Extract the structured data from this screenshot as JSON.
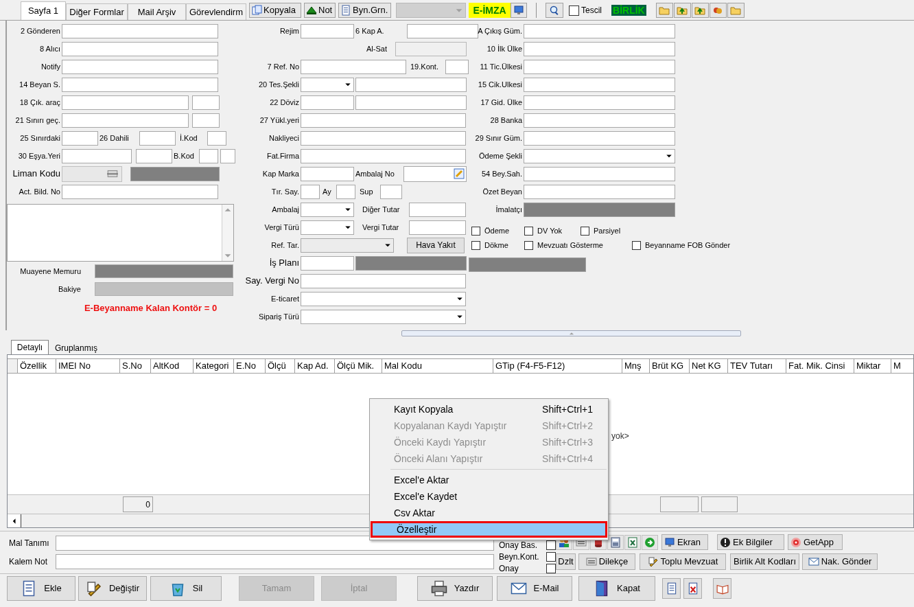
{
  "top_tabs": [
    {
      "label": "Sayfa 1",
      "selected": true
    },
    {
      "label": "Diğer Formlar",
      "selected": false
    },
    {
      "label": "Mail Arşiv",
      "selected": false
    },
    {
      "label": "Görevlendirm",
      "selected": false
    }
  ],
  "toolbar": {
    "buttons": [
      {
        "label": "Kopyala"
      },
      {
        "label": "Not"
      },
      {
        "label": "Byn.Grn."
      }
    ],
    "eimza": "E-İMZA",
    "tescil": {
      "label": "Tescil",
      "checked": false
    },
    "birlik": "BİRLİK"
  },
  "form": {
    "left": [
      [
        {
          "kind": "label",
          "text": "2 Gönderen"
        },
        {
          "kind": "input"
        }
      ],
      [
        {
          "kind": "label",
          "text": "8 Alıcı"
        },
        {
          "kind": "input"
        }
      ],
      [
        {
          "kind": "label",
          "text": "Notify"
        },
        {
          "kind": "input"
        }
      ],
      [
        {
          "kind": "label",
          "text": "14 Beyan S."
        },
        {
          "kind": "input"
        }
      ],
      [
        {
          "kind": "label",
          "text": "18 Çık. araç"
        },
        {
          "kind": "input"
        },
        {
          "kind": "input"
        }
      ],
      [
        {
          "kind": "label",
          "text": "21 Sınırı geç."
        },
        {
          "kind": "input"
        },
        {
          "kind": "input"
        }
      ],
      [
        {
          "kind": "label",
          "text": "25 Sınırdaki"
        },
        {
          "kind": "input"
        },
        {
          "kind": "label",
          "text": "26 Dahili"
        },
        {
          "kind": "input"
        },
        {
          "kind": "label",
          "text": "İ.Kod"
        },
        {
          "kind": "input"
        }
      ],
      [
        {
          "kind": "label",
          "text": "30 Eşya.Yeri"
        },
        {
          "kind": "input"
        },
        {
          "kind": "input"
        },
        {
          "kind": "label",
          "text": "B.Kod"
        },
        {
          "kind": "input"
        },
        {
          "kind": "input"
        }
      ],
      [
        {
          "kind": "label_lg",
          "text": "Liman Kodu"
        },
        {
          "kind": "lookup"
        },
        {
          "kind": "dark"
        }
      ],
      [
        {
          "kind": "label",
          "text": "Act. Bild. No"
        },
        {
          "kind": "input"
        }
      ]
    ],
    "middle": [
      [
        {
          "kind": "label",
          "text": "Rejim"
        },
        {
          "kind": "input"
        },
        {
          "kind": "label",
          "text": "6 Kap A."
        },
        {
          "kind": "input"
        }
      ],
      [
        {
          "kind": "label",
          "text": "Al-Sat"
        },
        {
          "kind": "readonly"
        }
      ],
      [
        {
          "kind": "label",
          "text": "7 Ref. No"
        },
        {
          "kind": "input"
        },
        {
          "kind": "label",
          "text": "19.Kont."
        },
        {
          "kind": "input"
        }
      ],
      [
        {
          "kind": "label",
          "text": "20 Tes.Şekli"
        },
        {
          "kind": "select"
        },
        {
          "kind": "input"
        }
      ],
      [
        {
          "kind": "label",
          "text": "22 Döviz"
        },
        {
          "kind": "input"
        },
        {
          "kind": "input"
        }
      ],
      [
        {
          "kind": "label",
          "text": "27 Yükl.yeri"
        },
        {
          "kind": "input"
        }
      ],
      [
        {
          "kind": "label",
          "text": "Nakliyeci"
        },
        {
          "kind": "input"
        }
      ],
      [
        {
          "kind": "label",
          "text": "Fat.Firma"
        },
        {
          "kind": "input"
        }
      ],
      [
        {
          "kind": "label",
          "text": "Kap Marka"
        },
        {
          "kind": "input"
        },
        {
          "kind": "label",
          "text": "Ambalaj No"
        },
        {
          "kind": "picker"
        }
      ],
      [
        {
          "kind": "label",
          "text": "Tır. Say."
        },
        {
          "kind": "input"
        },
        {
          "kind": "label",
          "text": "Ay"
        },
        {
          "kind": "input"
        },
        {
          "kind": "label",
          "text": "Sup"
        },
        {
          "kind": "input"
        }
      ],
      [
        {
          "kind": "label",
          "text": "Ambalaj"
        },
        {
          "kind": "select"
        },
        {
          "kind": "label",
          "text": "Diğer Tutar"
        },
        {
          "kind": "input"
        }
      ],
      [
        {
          "kind": "label",
          "text": "Vergi Türü"
        },
        {
          "kind": "select"
        },
        {
          "kind": "label",
          "text": "Vergi Tutar"
        },
        {
          "kind": "input"
        }
      ],
      [
        {
          "kind": "label",
          "text": "Ref. Tar."
        },
        {
          "kind": "select_disabled"
        },
        {
          "kind": "button",
          "text": "Hava Yakıt"
        }
      ],
      [
        {
          "kind": "label_lg",
          "text": "İş Planı"
        },
        {
          "kind": "input"
        },
        {
          "kind": "dark"
        }
      ],
      [
        {
          "kind": "label_lg",
          "text": "Say. Vergi No"
        },
        {
          "kind": "input"
        }
      ],
      [
        {
          "kind": "label",
          "text": "E-ticaret"
        },
        {
          "kind": "select"
        }
      ],
      [
        {
          "kind": "label",
          "text": "Sipariş Türü"
        },
        {
          "kind": "select"
        }
      ]
    ],
    "right": [
      [
        {
          "kind": "label",
          "text": "A Çıkış Güm."
        },
        {
          "kind": "input"
        }
      ],
      [
        {
          "kind": "label",
          "text": "10 İlk Ülke"
        },
        {
          "kind": "input"
        }
      ],
      [
        {
          "kind": "label",
          "text": "11 Tic.Ülkesi"
        },
        {
          "kind": "input"
        }
      ],
      [
        {
          "kind": "label",
          "text": "15 Cik.Ulkesi"
        },
        {
          "kind": "input"
        }
      ],
      [
        {
          "kind": "label",
          "text": "17 Gid. Ülke"
        },
        {
          "kind": "input"
        }
      ],
      [
        {
          "kind": "label",
          "text": "28 Banka"
        },
        {
          "kind": "input"
        }
      ],
      [
        {
          "kind": "label",
          "text": "29 Sınır Güm."
        },
        {
          "kind": "input"
        }
      ],
      [
        {
          "kind": "label",
          "text": "Ödeme Şekli"
        },
        {
          "kind": "select"
        }
      ],
      [
        {
          "kind": "label",
          "text": "54 Bey.Sah."
        },
        {
          "kind": "input"
        }
      ],
      [
        {
          "kind": "label",
          "text": "Özet Beyan"
        },
        {
          "kind": "input"
        }
      ],
      [
        {
          "kind": "label",
          "text": "İmalatçı"
        },
        {
          "kind": "dark"
        }
      ],
      [
        {
          "kind": "checkbox",
          "text": "Ödeme",
          "checked": false
        },
        {
          "kind": "checkbox",
          "text": "DV Yok",
          "checked": false
        },
        {
          "kind": "checkbox",
          "text": "Parsiyel",
          "checked": false
        }
      ],
      [
        {
          "kind": "checkbox",
          "text": "Dökme",
          "checked": false
        },
        {
          "kind": "checkbox",
          "text": "Mevzuatı Gösterme",
          "checked": false
        },
        {
          "kind": "checkbox",
          "text": "Beyanname FOB Gönder",
          "checked": false
        }
      ],
      [
        {
          "kind": "dark"
        }
      ]
    ]
  },
  "memo_labels": [
    "Muayene Memuru",
    "Bakiye"
  ],
  "kontor_text": "E-Beyanname Kalan Kontör = 0",
  "grid_tabs": [
    {
      "label": "Detaylı",
      "selected": true
    },
    {
      "label": "Gruplanmış",
      "selected": false
    }
  ],
  "table": {
    "columns": [
      "Özellik",
      "IMEI No",
      "S.No",
      "AltKod",
      "Kategori",
      "E.No",
      "Ölçü",
      "Kap Ad.",
      "Ölçü Mik.",
      "Mal Kodu",
      "GTip (F4-F5-F12)",
      "Mnş",
      "Brüt KG",
      "Net KG",
      "TEV Tutarı",
      "Fat. Mik. Cinsi",
      "Miktar",
      "M"
    ],
    "empty_message": "yok>",
    "footer_total": "0"
  },
  "context_menu": [
    {
      "kind": "item",
      "label": "Kayıt Kopyala",
      "shortcut": "Shift+Ctrl+1",
      "disabled": false,
      "selected": false
    },
    {
      "kind": "item",
      "label": "Kopyalanan Kaydı Yapıştır",
      "shortcut": "Shift+Ctrl+2",
      "disabled": true,
      "selected": false
    },
    {
      "kind": "item",
      "label": "Önceki Kaydı Yapıştır",
      "shortcut": "Shift+Ctrl+3",
      "disabled": true,
      "selected": false
    },
    {
      "kind": "item",
      "label": "Önceki Alanı Yapıştır",
      "shortcut": "Shift+Ctrl+4",
      "disabled": true,
      "selected": false
    },
    {
      "kind": "separator"
    },
    {
      "kind": "item",
      "label": "Excel'e Aktar",
      "disabled": false,
      "selected": false
    },
    {
      "kind": "item",
      "label": "Excel'e Kaydet",
      "disabled": false,
      "selected": false
    },
    {
      "kind": "item",
      "label": "Csv Aktar",
      "disabled": false,
      "selected": false
    },
    {
      "kind": "item",
      "label": "Özelleştir",
      "disabled": false,
      "selected": true
    }
  ],
  "bottom": {
    "fields": [
      "Mal Tanımı",
      "Kalem Not"
    ],
    "checks": [
      {
        "label": "Onay Bas.",
        "checked": false
      },
      {
        "label": "Beyn.Kont.",
        "checked": false
      },
      {
        "label": "Onay",
        "checked": false
      }
    ],
    "row1_buttons": [
      "Ekran",
      "Ek Bilgiler",
      "GetApp"
    ],
    "row2_buttons": [
      "Dzlt",
      "Dilekçe",
      "Toplu Mevzuat",
      "Birlik Alt Kodları",
      "Nak. Gönder"
    ]
  },
  "actions": [
    {
      "label": "Ekle",
      "disabled": false
    },
    {
      "label": "Değiştir",
      "disabled": false
    },
    {
      "label": "Sil",
      "disabled": false
    },
    {
      "label": "Tamam",
      "disabled": true
    },
    {
      "label": "İptal",
      "disabled": true
    },
    {
      "label": "Yazdır",
      "disabled": false
    },
    {
      "label": "E-Mail",
      "disabled": false
    },
    {
      "label": "Kapat",
      "disabled": false
    }
  ]
}
